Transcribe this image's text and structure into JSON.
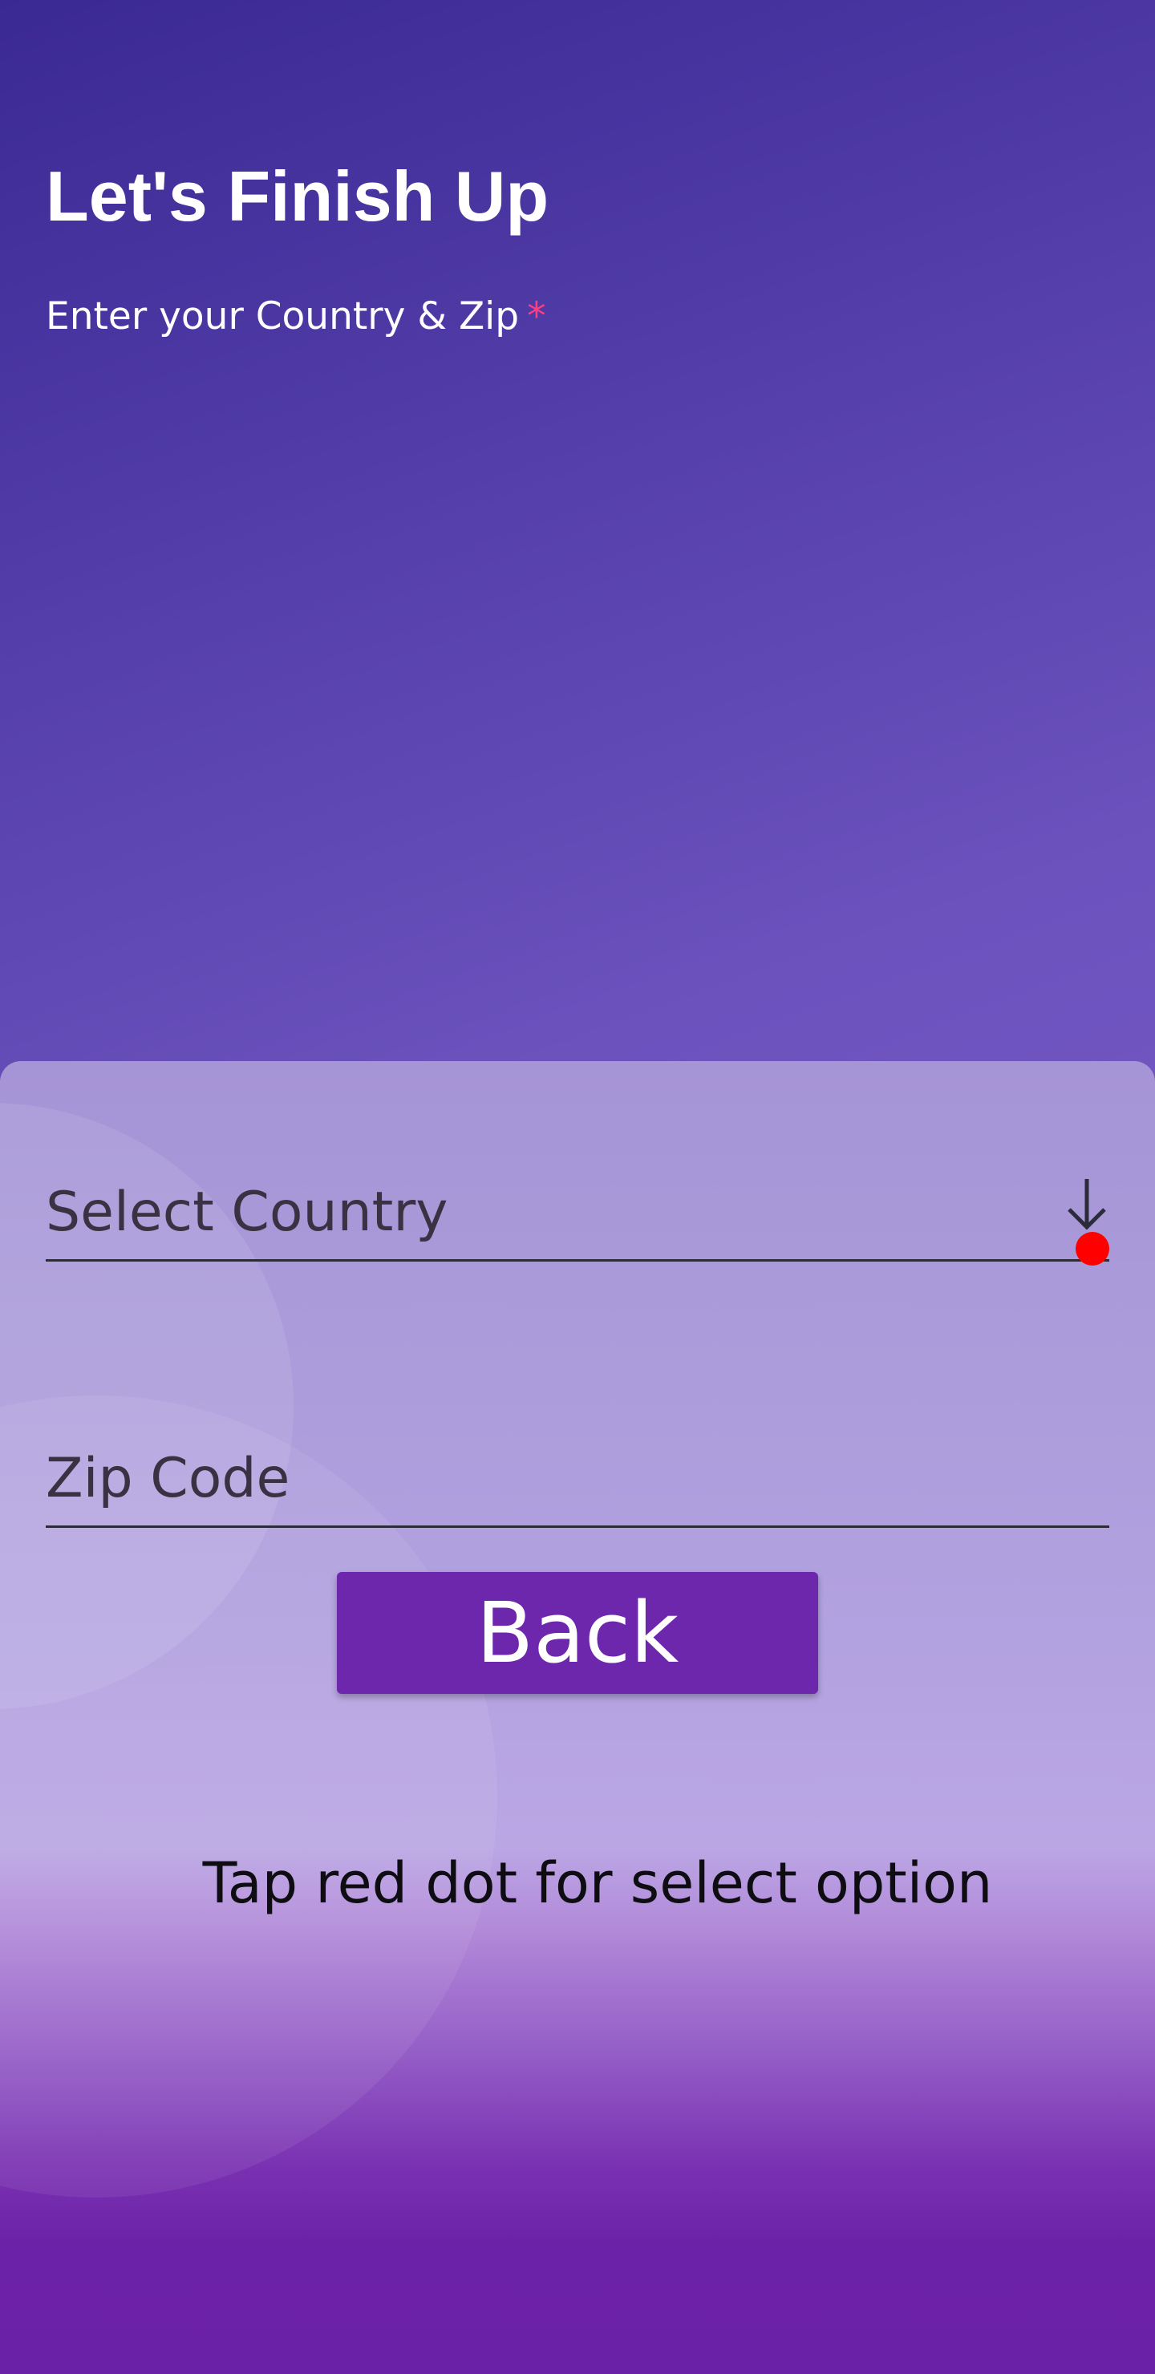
{
  "header": {
    "title": "Let's Finish Up",
    "subtitle": "Enter your Country & Zip",
    "required_mark": "*"
  },
  "form": {
    "country": {
      "placeholder": "Select Country",
      "icon": "arrow-down-icon"
    },
    "zip": {
      "placeholder": "Zip Code"
    }
  },
  "actions": {
    "back_label": "Back"
  },
  "hint": "Tap red dot for select option",
  "colors": {
    "button": "#6c27ad",
    "red_dot": "#ff0000",
    "required": "#ff3d7f"
  }
}
